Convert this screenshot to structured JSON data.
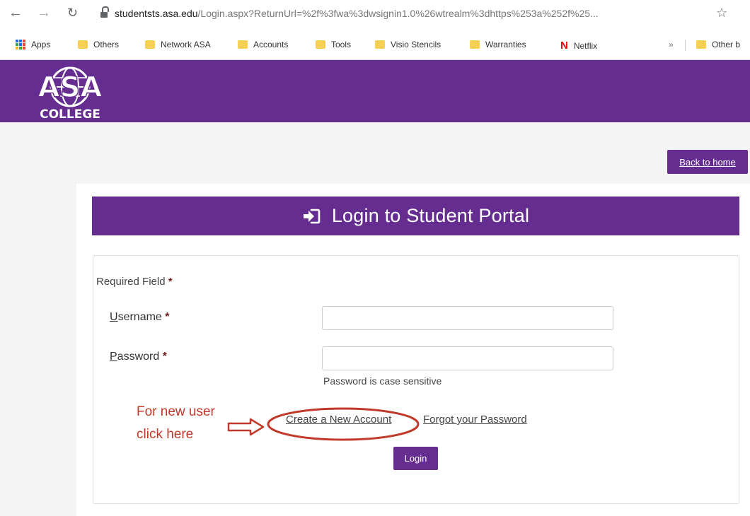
{
  "browser": {
    "url_domain": "studentsts.asa.edu",
    "url_path": "/Login.aspx?ReturnUrl=%2f%3fwa%3dwsignin1.0%26wtrealm%3dhttps%253a%252f%25...",
    "bookmarks": [
      {
        "label": "Apps",
        "icon": "apps-icon"
      },
      {
        "label": "Others",
        "icon": "folder-icon"
      },
      {
        "label": "Network ASA",
        "icon": "folder-icon"
      },
      {
        "label": "Accounts",
        "icon": "folder-icon"
      },
      {
        "label": "Tools",
        "icon": "folder-icon"
      },
      {
        "label": "Visio Stencils",
        "icon": "folder-icon"
      },
      {
        "label": "Warranties",
        "icon": "folder-icon"
      },
      {
        "label": "Netflix",
        "icon": "netflix-icon"
      }
    ],
    "overflow_label": "»",
    "other_bookmarks_label": "Other b"
  },
  "site": {
    "logo_text": "ASA",
    "logo_subtext": "COLLEGE",
    "brand_color": "#662d91",
    "back_home_label": "Back to home"
  },
  "login": {
    "title": "Login to Student Portal",
    "required_label": "Required Field",
    "asterisk": "*",
    "username_label_first": "U",
    "username_label_rest": "sername",
    "password_label_first": "P",
    "password_label_rest": "assword",
    "username_value": "",
    "password_value": "",
    "password_hint": "Password is case sensitive",
    "create_account_label": "Create a New Account",
    "forgot_password_label": "Forgot your Password",
    "login_button_label": "Login"
  },
  "annotation": {
    "line1": "For new user",
    "line2": "click here",
    "color": "#c0392b"
  }
}
